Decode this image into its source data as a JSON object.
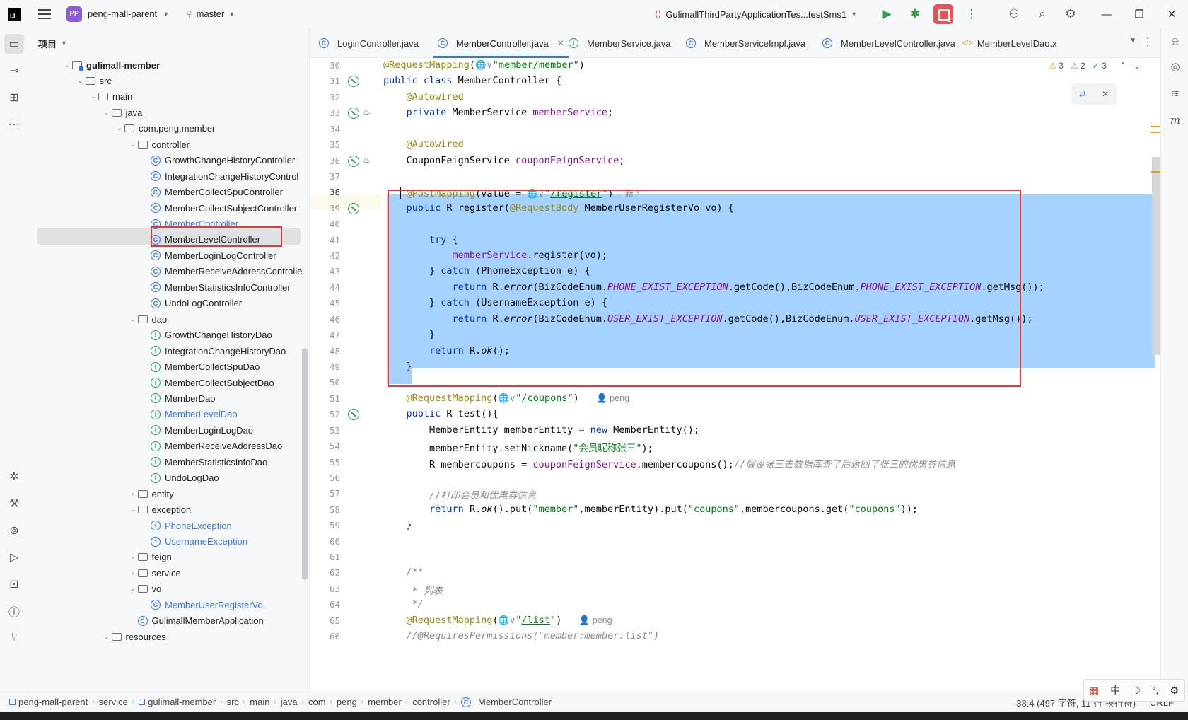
{
  "titlebar": {
    "project_badge": "PP",
    "project_name": "peng-mall-parent",
    "branch": "master",
    "run_config": "GulimallThirdPartyApplicationTes...testSms1",
    "stop_badge": "2"
  },
  "project_pane": {
    "title": "项目",
    "tree": [
      {
        "label": "gulimall-member",
        "kind": "module",
        "depth": 0,
        "expanded": true,
        "bold": true
      },
      {
        "label": "src",
        "kind": "folder",
        "depth": 1,
        "expanded": true
      },
      {
        "label": "main",
        "kind": "folder",
        "depth": 2,
        "expanded": true
      },
      {
        "label": "java",
        "kind": "folder",
        "depth": 3,
        "expanded": true
      },
      {
        "label": "com.peng.member",
        "kind": "folder",
        "depth": 4,
        "expanded": true
      },
      {
        "label": "controller",
        "kind": "folder",
        "depth": 5,
        "expanded": true
      },
      {
        "label": "GrowthChangeHistoryController",
        "kind": "class",
        "depth": 6
      },
      {
        "label": "IntegrationChangeHistoryControl",
        "kind": "class",
        "depth": 6
      },
      {
        "label": "MemberCollectSpuController",
        "kind": "class",
        "depth": 6
      },
      {
        "label": "MemberCollectSubjectController",
        "kind": "class",
        "depth": 6
      },
      {
        "label": "MemberController",
        "kind": "class",
        "depth": 6,
        "selected": true,
        "blue": true
      },
      {
        "label": "MemberLevelController",
        "kind": "class",
        "depth": 6
      },
      {
        "label": "MemberLoginLogController",
        "kind": "class",
        "depth": 6
      },
      {
        "label": "MemberReceiveAddressControlle",
        "kind": "class",
        "depth": 6
      },
      {
        "label": "MemberStatisticsInfoController",
        "kind": "class",
        "depth": 6
      },
      {
        "label": "UndoLogController",
        "kind": "class",
        "depth": 6
      },
      {
        "label": "dao",
        "kind": "folder",
        "depth": 5,
        "expanded": true
      },
      {
        "label": "GrowthChangeHistoryDao",
        "kind": "iface",
        "depth": 6
      },
      {
        "label": "IntegrationChangeHistoryDao",
        "kind": "iface",
        "depth": 6
      },
      {
        "label": "MemberCollectSpuDao",
        "kind": "iface",
        "depth": 6
      },
      {
        "label": "MemberCollectSubjectDao",
        "kind": "iface",
        "depth": 6
      },
      {
        "label": "MemberDao",
        "kind": "iface",
        "depth": 6
      },
      {
        "label": "MemberLevelDao",
        "kind": "iface",
        "depth": 6,
        "blue": true
      },
      {
        "label": "MemberLoginLogDao",
        "kind": "iface",
        "depth": 6
      },
      {
        "label": "MemberReceiveAddressDao",
        "kind": "iface",
        "depth": 6
      },
      {
        "label": "MemberStatisticsInfoDao",
        "kind": "iface",
        "depth": 6
      },
      {
        "label": "UndoLogDao",
        "kind": "iface",
        "depth": 6
      },
      {
        "label": "entity",
        "kind": "folder",
        "depth": 5,
        "expanded": false
      },
      {
        "label": "exception",
        "kind": "folder",
        "depth": 5,
        "expanded": true
      },
      {
        "label": "PhoneException",
        "kind": "exc",
        "depth": 6,
        "blue": true
      },
      {
        "label": "UsernameException",
        "kind": "exc",
        "depth": 6,
        "blue": true
      },
      {
        "label": "feign",
        "kind": "folder",
        "depth": 5,
        "expanded": false
      },
      {
        "label": "service",
        "kind": "folder",
        "depth": 5,
        "expanded": false
      },
      {
        "label": "vo",
        "kind": "folder",
        "depth": 5,
        "expanded": true
      },
      {
        "label": "MemberUserRegisterVo",
        "kind": "class",
        "depth": 6,
        "blue": true
      },
      {
        "label": "GulimallMemberApplication",
        "kind": "app",
        "depth": 5
      },
      {
        "label": "resources",
        "kind": "folder",
        "depth": 3,
        "expanded": true
      }
    ]
  },
  "tabs": [
    {
      "label": "LoginController.java",
      "kind": "class"
    },
    {
      "label": "MemberController.java",
      "kind": "class",
      "active": true
    },
    {
      "label": "MemberService.java",
      "kind": "iface"
    },
    {
      "label": "MemberServiceImpl.java",
      "kind": "class"
    },
    {
      "label": "MemberLevelController.java",
      "kind": "class"
    },
    {
      "label": "MemberLevelDao.x",
      "kind": "xml"
    }
  ],
  "inspections": {
    "warnings": "3",
    "weak_warnings": "2",
    "ok": "3"
  },
  "code_lines": [
    {
      "n": "30",
      "t": [
        [
          "ann",
          "@RequestMapping"
        ],
        [
          "",
          "("
        ],
        [
          "inlay",
          "🌐∨"
        ],
        [
          "str",
          "\""
        ],
        [
          "url",
          "member/member"
        ],
        [
          "str",
          "\""
        ],
        [
          "",
          ")"
        ]
      ]
    },
    {
      "n": "31",
      "t": [
        [
          "kw",
          "public class "
        ],
        [
          "",
          "MemberController {"
        ]
      ]
    },
    {
      "n": "32",
      "t": [
        [
          "",
          "    "
        ],
        [
          "ann",
          "@Autowired"
        ]
      ]
    },
    {
      "n": "33",
      "t": [
        [
          "",
          "    "
        ],
        [
          "kw",
          "private "
        ],
        [
          "",
          "MemberService "
        ],
        [
          "fld",
          "memberService"
        ],
        [
          "",
          ";"
        ]
      ]
    },
    {
      "n": "34",
      "t": []
    },
    {
      "n": "35",
      "t": [
        [
          "",
          "    "
        ],
        [
          "ann",
          "@Autowired"
        ]
      ]
    },
    {
      "n": "36",
      "t": [
        [
          "",
          "    CouponFeignService "
        ],
        [
          "fld",
          "couponFeignService"
        ],
        [
          "",
          ";"
        ]
      ]
    },
    {
      "n": "37",
      "t": []
    },
    {
      "n": "38",
      "t": [
        [
          "",
          "    "
        ],
        [
          "ann",
          "@PostMapping"
        ],
        [
          "",
          "(value = "
        ],
        [
          "inlay",
          "🌐∨"
        ],
        [
          "str",
          "\""
        ],
        [
          "url",
          "/register"
        ],
        [
          "str",
          "\""
        ],
        [
          "",
          ")  "
        ],
        [
          "inlay",
          "新 *"
        ]
      ]
    },
    {
      "n": "39",
      "t": [
        [
          "",
          "    "
        ],
        [
          "kw",
          "public "
        ],
        [
          "",
          "R "
        ],
        [
          "",
          "register("
        ],
        [
          "ann",
          "@RequestBody "
        ],
        [
          "",
          "MemberUserRegisterVo vo) {"
        ]
      ]
    },
    {
      "n": "40",
      "t": []
    },
    {
      "n": "41",
      "t": [
        [
          "",
          "        "
        ],
        [
          "kw",
          "try "
        ],
        [
          "",
          "{"
        ]
      ]
    },
    {
      "n": "42",
      "t": [
        [
          "",
          "            "
        ],
        [
          "fld",
          "memberService"
        ],
        [
          "",
          ".register(vo);"
        ]
      ]
    },
    {
      "n": "43",
      "t": [
        [
          "",
          "        } "
        ],
        [
          "kw",
          "catch "
        ],
        [
          "",
          "(PhoneException e) {"
        ]
      ]
    },
    {
      "n": "44",
      "t": [
        [
          "",
          "            "
        ],
        [
          "kw",
          "return "
        ],
        [
          "",
          "R."
        ],
        [
          "itl",
          "error"
        ],
        [
          "",
          "(BizCodeEnum."
        ],
        [
          "sfld",
          "PHONE_EXIST_EXCEPTION"
        ],
        [
          "",
          ".getCode(),BizCodeEnum."
        ],
        [
          "sfld",
          "PHONE_EXIST_EXCEPTION"
        ],
        [
          "",
          ".getMsg());"
        ]
      ]
    },
    {
      "n": "45",
      "t": [
        [
          "",
          "        } "
        ],
        [
          "kw",
          "catch "
        ],
        [
          "",
          "(UsernameException e) {"
        ]
      ]
    },
    {
      "n": "46",
      "t": [
        [
          "",
          "            "
        ],
        [
          "kw",
          "return "
        ],
        [
          "",
          "R."
        ],
        [
          "itl",
          "error"
        ],
        [
          "",
          "(BizCodeEnum."
        ],
        [
          "sfld",
          "USER_EXIST_EXCEPTION"
        ],
        [
          "",
          ".getCode(),BizCodeEnum."
        ],
        [
          "sfld",
          "USER_EXIST_EXCEPTION"
        ],
        [
          "",
          ".getMsg());"
        ]
      ]
    },
    {
      "n": "47",
      "t": [
        [
          "",
          "        }"
        ]
      ]
    },
    {
      "n": "48",
      "t": [
        [
          "",
          "        "
        ],
        [
          "kw",
          "return "
        ],
        [
          "",
          "R."
        ],
        [
          "itl",
          "ok"
        ],
        [
          "",
          "();"
        ]
      ]
    },
    {
      "n": "49",
      "t": [
        [
          "",
          "    }"
        ]
      ]
    },
    {
      "n": "50",
      "t": []
    },
    {
      "n": "51",
      "t": [
        [
          "",
          "    "
        ],
        [
          "ann",
          "@RequestMapping"
        ],
        [
          "",
          "("
        ],
        [
          "inlay",
          "🌐∨"
        ],
        [
          "str",
          "\""
        ],
        [
          "url",
          "/coupons"
        ],
        [
          "str",
          "\""
        ],
        [
          "",
          ")   "
        ],
        [
          "inlay",
          "👤 peng"
        ]
      ]
    },
    {
      "n": "52",
      "t": [
        [
          "",
          "    "
        ],
        [
          "kw",
          "public "
        ],
        [
          "",
          "R test(){"
        ]
      ]
    },
    {
      "n": "53",
      "t": [
        [
          "",
          "        MemberEntity memberEntity = "
        ],
        [
          "kw",
          "new "
        ],
        [
          "",
          "MemberEntity();"
        ]
      ]
    },
    {
      "n": "54",
      "t": [
        [
          "",
          "        memberEntity.setNickname("
        ],
        [
          "str",
          "\"会员昵称张三\""
        ],
        [
          "",
          ");"
        ]
      ]
    },
    {
      "n": "55",
      "t": [
        [
          "",
          "        R membercoupons = "
        ],
        [
          "fld",
          "couponFeignService"
        ],
        [
          "",
          ".membercoupons();"
        ],
        [
          "cmt",
          "//假设张三去数据库查了后返回了张三的优惠券信息"
        ]
      ]
    },
    {
      "n": "56",
      "t": []
    },
    {
      "n": "57",
      "t": [
        [
          "",
          "        "
        ],
        [
          "cmt",
          "//打印会员和优惠券信息"
        ]
      ]
    },
    {
      "n": "58",
      "t": [
        [
          "",
          "        "
        ],
        [
          "kw",
          "return "
        ],
        [
          "",
          "R."
        ],
        [
          "itl",
          "ok"
        ],
        [
          "",
          "().put("
        ],
        [
          "str",
          "\"member\""
        ],
        [
          "",
          ",memberEntity).put("
        ],
        [
          "str",
          "\"coupons\""
        ],
        [
          "",
          ",membercoupons.get("
        ],
        [
          "str",
          "\"coupons\""
        ],
        [
          "",
          "));"
        ]
      ]
    },
    {
      "n": "59",
      "t": [
        [
          "",
          "    }"
        ]
      ]
    },
    {
      "n": "60",
      "t": []
    },
    {
      "n": "61",
      "t": []
    },
    {
      "n": "62",
      "t": [
        [
          "",
          "    "
        ],
        [
          "cmt",
          "/**"
        ]
      ]
    },
    {
      "n": "63",
      "t": [
        [
          "",
          "     "
        ],
        [
          "cmt",
          "* 列表"
        ]
      ]
    },
    {
      "n": "64",
      "t": [
        [
          "",
          "     "
        ],
        [
          "cmt",
          "*/"
        ]
      ]
    },
    {
      "n": "65",
      "t": [
        [
          "",
          "    "
        ],
        [
          "ann",
          "@RequestMapping"
        ],
        [
          "",
          "("
        ],
        [
          "inlay",
          "🌐∨"
        ],
        [
          "str",
          "\""
        ],
        [
          "url",
          "/list"
        ],
        [
          "str",
          "\""
        ],
        [
          "",
          ")   "
        ],
        [
          "inlay",
          "👤 peng"
        ]
      ]
    },
    {
      "n": "66",
      "t": [
        [
          "",
          "    "
        ],
        [
          "cmt",
          "//@RequiresPermissions(\"member:member:list\")"
        ]
      ]
    }
  ],
  "statusbar": {
    "crumbs": [
      "peng-mall-parent",
      "service",
      "gulimall-member",
      "src",
      "main",
      "java",
      "com",
      "peng",
      "member",
      "controller",
      "MemberController"
    ],
    "position": "38:4 (497 字符, 11 行 换行符)",
    "line_sep": "CRLF"
  },
  "ime": {
    "lang": "中",
    "moon": "☽",
    "punct": "°,",
    "gear": "⚙"
  }
}
